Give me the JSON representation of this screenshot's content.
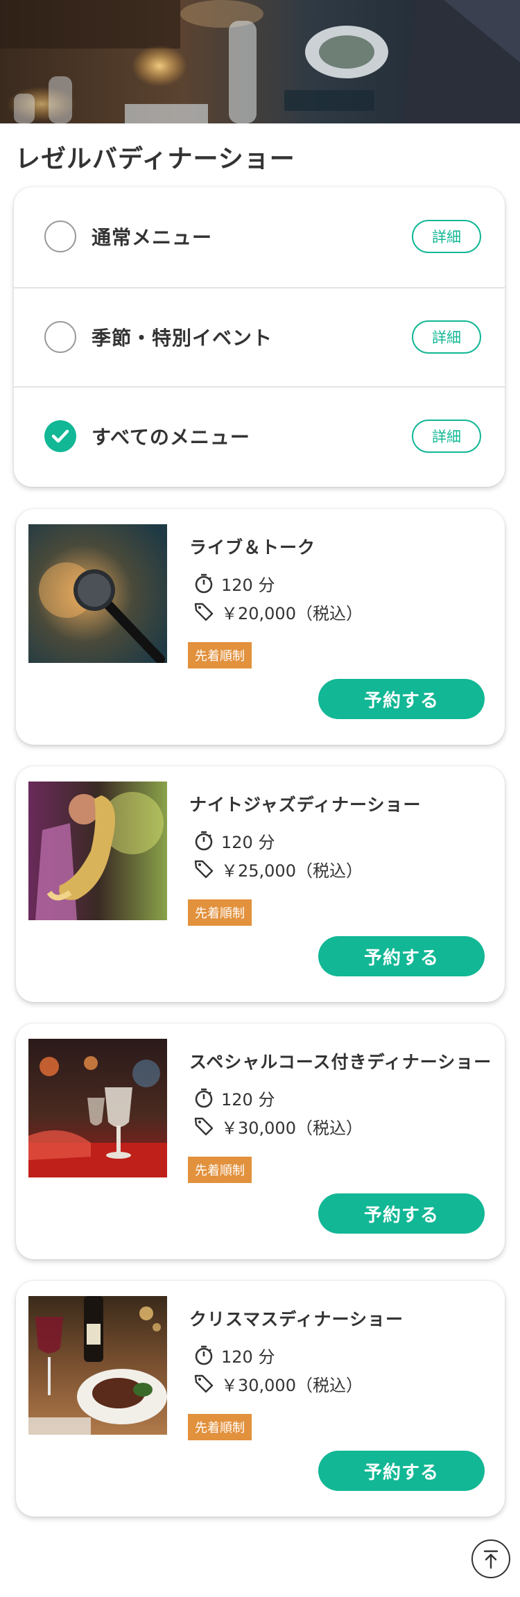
{
  "page": {
    "title": "レゼルバディナーショー"
  },
  "filters": [
    {
      "label": "通常メニュー",
      "detail_label": "詳細",
      "checked": false,
      "icon": "check-icon"
    },
    {
      "label": "季節・特別イベント",
      "detail_label": "詳細",
      "checked": false,
      "icon": "check-icon"
    },
    {
      "label": "すべてのメニュー",
      "detail_label": "詳細",
      "checked": true,
      "icon": "check-icon"
    }
  ],
  "menus": [
    {
      "title": "ライブ＆トーク",
      "duration": "120 分",
      "price": "￥20,000（税込）",
      "badge": "先着順制",
      "reserve_label": "予約する",
      "image": "microphone-photo"
    },
    {
      "title": "ナイトジャズディナーショー",
      "duration": "120 分",
      "price": "￥25,000（税込）",
      "badge": "先着順制",
      "reserve_label": "予約する",
      "image": "saxophone-photo"
    },
    {
      "title": "スペシャルコース付きディナーショー",
      "duration": "120 分",
      "price": "￥30,000（税込）",
      "badge": "先着順制",
      "reserve_label": "予約する",
      "image": "glasses-photo"
    },
    {
      "title": "クリスマスディナーショー",
      "duration": "120 分",
      "price": "￥30,000（税込）",
      "badge": "先着順制",
      "reserve_label": "予約する",
      "image": "steak-dinner-photo"
    }
  ],
  "icons": {
    "duration": "stopwatch-icon",
    "price": "tag-icon",
    "scroll_top": "arrow-up-icon"
  },
  "colors": {
    "accent": "#12b795",
    "badge": "#e2913d",
    "text": "#333333"
  }
}
